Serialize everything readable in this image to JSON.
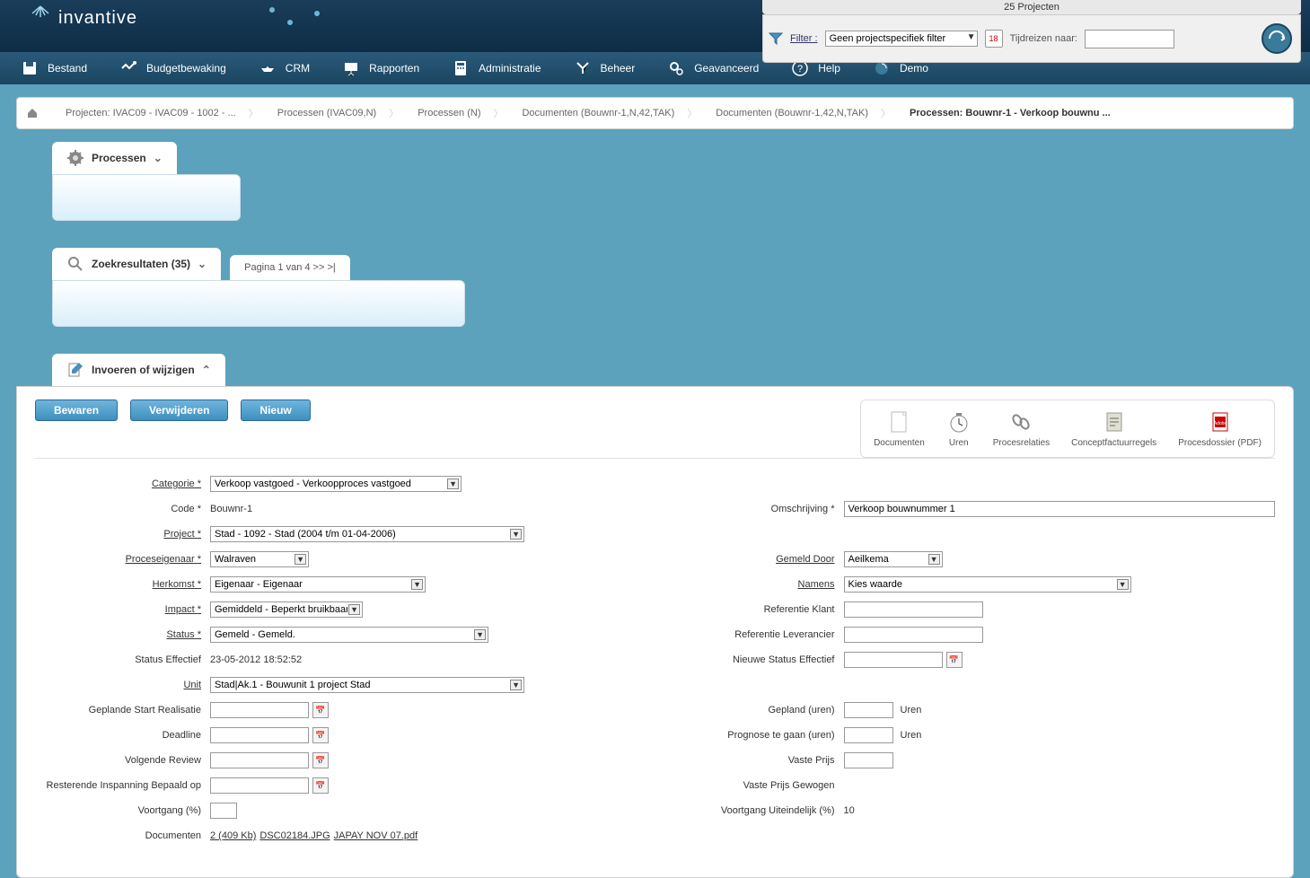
{
  "header": {
    "logo_text": "invantive",
    "project_count": "25 Projecten",
    "filter_label": "Filter :",
    "filter_value": "Geen projectspecifiek filter",
    "calendar_day": "18",
    "time_travel_label": "Tijdreizen naar:",
    "time_travel_value": ""
  },
  "menu": [
    {
      "icon": "save",
      "label": "Bestand"
    },
    {
      "icon": "budget",
      "label": "Budgetbewaking"
    },
    {
      "icon": "crm",
      "label": "CRM"
    },
    {
      "icon": "reports",
      "label": "Rapporten"
    },
    {
      "icon": "admin",
      "label": "Administratie"
    },
    {
      "icon": "manage",
      "label": "Beheer"
    },
    {
      "icon": "advanced",
      "label": "Geavanceerd"
    },
    {
      "icon": "help",
      "label": "Help"
    },
    {
      "icon": "demo",
      "label": "Demo"
    }
  ],
  "breadcrumb": [
    "Projecten: IVAC09 - IVAC09 - 1002 - ...",
    "Processen (IVAC09,N)",
    "Processen (N)",
    "Documenten (Bouwnr-1,N,42,TAK)",
    "Documenten (Bouwnr-1,42,N,TAK)",
    "Processen: Bouwnr-1 - Verkoop bouwnu ..."
  ],
  "tabs": {
    "processen": "Processen",
    "zoekresultaten": "Zoekresultaten (35)",
    "pagination": "Pagina 1 van 4 >> >|",
    "edit": "Invoeren of wijzigen"
  },
  "buttons": {
    "save": "Bewaren",
    "delete": "Verwijderen",
    "new": "Nieuw"
  },
  "side_actions": [
    {
      "icon": "doc",
      "label": "Documenten"
    },
    {
      "icon": "clock",
      "label": "Uren"
    },
    {
      "icon": "link",
      "label": "Procesrelaties"
    },
    {
      "icon": "invoice",
      "label": "Conceptfactuurregels"
    },
    {
      "icon": "pdf",
      "label": "Procesdossier (PDF)"
    }
  ],
  "form": {
    "labels": {
      "categorie": "Categorie",
      "code": "Code",
      "project": "Project",
      "proceseigenaar": "Proceseigenaar",
      "herkomst": "Herkomst",
      "impact": "Impact",
      "status": "Status",
      "status_effectief": "Status Effectief",
      "unit": "Unit",
      "geplande_start": "Geplande Start Realisatie",
      "deadline": "Deadline",
      "volgende_review": "Volgende Review",
      "resterende": "Resterende Inspanning Bepaald op",
      "voortgang": "Voortgang (%)",
      "documenten": "Documenten",
      "omschrijving": "Omschrijving",
      "gemeld_door": "Gemeld Door",
      "namens": "Namens",
      "referentie_klant": "Referentie Klant",
      "referentie_leverancier": "Referentie Leverancier",
      "nieuwe_status": "Nieuwe Status Effectief",
      "gepland_uren": "Gepland (uren)",
      "prognose": "Prognose te gaan (uren)",
      "vaste_prijs": "Vaste Prijs",
      "vaste_prijs_gewogen": "Vaste Prijs Gewogen",
      "voortgang_uiteindelijk": "Voortgang Uiteindelijk (%)"
    },
    "values": {
      "categorie": "Verkoop vastgoed - Verkoopproces vastgoed",
      "code": "Bouwnr-1",
      "project": "Stad - 1092 - Stad (2004 t/m 01-04-2006)",
      "proceseigenaar": "Walraven",
      "herkomst": "Eigenaar - Eigenaar",
      "impact": "Gemiddeld - Beperkt bruikbaar.",
      "status": "Gemeld - Gemeld.",
      "status_effectief": "23-05-2012 18:52:52",
      "unit": "Stad|Ak.1 - Bouwunit 1 project Stad",
      "omschrijving": "Verkoop bouwnummer 1",
      "gemeld_door": "Aeilkema",
      "namens": "Kies waarde",
      "voortgang_uiteindelijk": "10",
      "uren_unit": "Uren",
      "doc_count": "2 (409 Kb)",
      "doc_1": "DSC02184.JPG",
      "doc_2": "JAPAY NOV 07.pdf"
    }
  }
}
